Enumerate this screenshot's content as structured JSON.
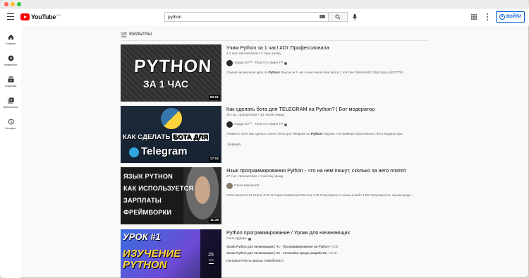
{
  "window": {
    "traffic_lights": [
      "close",
      "minimize",
      "zoom"
    ]
  },
  "header": {
    "logo_text": "YouTube",
    "logo_region": "RU",
    "search_value": "python",
    "signin_label": "ВОЙТИ"
  },
  "sidebar": {
    "items": [
      {
        "label": "Главная",
        "icon": "home-icon"
      },
      {
        "label": "Навигатор",
        "icon": "compass-icon"
      },
      {
        "label": "Подписки",
        "icon": "subscriptions-icon"
      },
      {
        "label": "Библиотека",
        "icon": "library-icon"
      },
      {
        "label": "История",
        "icon": "history-icon"
      }
    ]
  },
  "filters": {
    "label": "ФИЛЬТРЫ"
  },
  "results": [
    {
      "title": "Учим Python за 1 час! #От Профессионала",
      "meta": "4,2 млн просмотров • 2 года назад",
      "channel": "Хауди Хо™ - Просто о мире IT!",
      "description_prefix": "Самый несекучный урок по ",
      "description_bold": "Python",
      "description_suffix": "! Выучи за 1 час и уже пиши свои проги ;) Хостинг (BetaHost): https://goo.gl/CF77Kl",
      "duration": "59:01",
      "thumb_text_1": "PYTHON",
      "thumb_text_2": "ЗА 1 ЧАС"
    },
    {
      "title": "Как сделать бота для TELEGRAM на Python? | Бот модератор",
      "meta": "30 тыс. просмотров • 12 часов назад",
      "channel": "Хауди Хо™ - Просто о мире IT!",
      "description_prefix": "Учимся с нуля как сделать своего бота для Telegram на ",
      "description_bold": "Python",
      "description_suffix": " Aiogram. На примере простенького бота модератора.",
      "badge": "Новинка",
      "duration": "17:02",
      "thumb_text_1a": "КАК СДЕЛАТЬ ",
      "thumb_text_1b": "БОТА ДЛЯ",
      "thumb_text_2": "Telegram"
    },
    {
      "title": "Язык программирования Python - что на нем пишут, сколько за него платят",
      "meta": "27 тыс. просмотров • 1 месяц назад",
      "channel": "Паша Корнилов",
      "description": "0:00 Начало 0:14 Опрос 0:32 История появления Питона 1:25 Популярность языка в вебе 1:55 Популярность языка среди ...",
      "duration": "11:39",
      "thumb_lines": [
        "ЯЗЫК PYTHON",
        "КАК ИСПОЛЬЗУЕТСЯ",
        "ЗАРПЛАТЫ",
        "ФРЕЙМВОРКИ"
      ]
    },
    {
      "title": "Python программирование / Уроки для начинающих",
      "channel": "Гоша Дударь",
      "playlist": [
        {
          "title": "Уроки Python для начинающих | #1 - Программирование на Python",
          "duration": "4:00"
        },
        {
          "title": "Уроки Python для начинающих | #2 - Установка среды разработки",
          "duration": "8:16"
        }
      ],
      "view_all": "ПОСМОТРЕТЬ ВЕСЬ ПЛЕЙЛИСТ",
      "count": "25",
      "thumb_text_1": "УРОК #1",
      "thumb_text_2": "ИЗУЧЕНИЕ",
      "thumb_text_3": "PYTHON"
    }
  ]
}
